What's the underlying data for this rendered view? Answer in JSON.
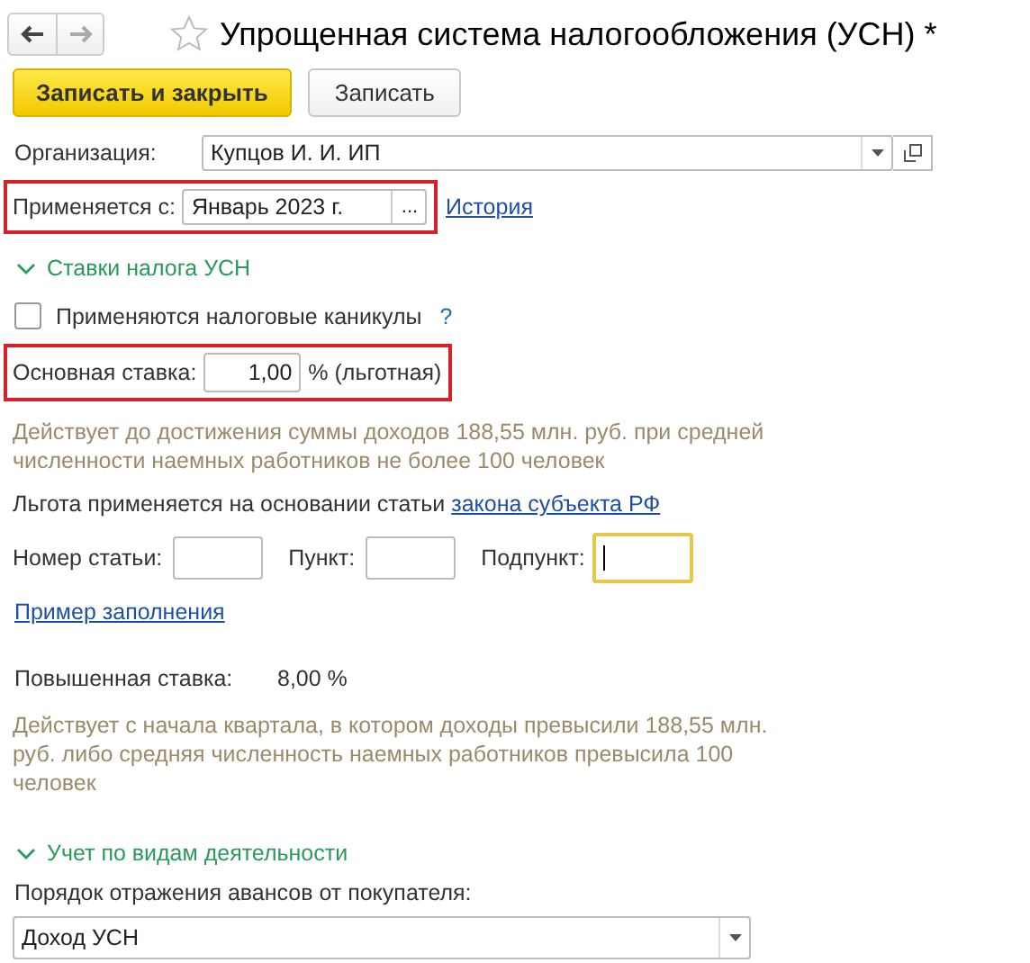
{
  "header": {
    "title": "Упрощенная система налогообложения (УСН) *",
    "favorite": false
  },
  "toolbar": {
    "buttons": [
      {
        "label": "Записать и закрыть",
        "kind": "primary"
      },
      {
        "label": "Записать",
        "kind": "default"
      }
    ]
  },
  "organization": {
    "label": "Организация:",
    "value": "Купцов И. И. ИП"
  },
  "applies_from": {
    "label": "Применяется с:",
    "value": "Январь 2023 г.",
    "button": "...",
    "link": "История",
    "highlighted": true
  },
  "rates_section": {
    "title": "Ставки налога УСН",
    "expanded": true
  },
  "holidays": {
    "label": "Применяются налоговые каникулы",
    "checked": false,
    "help": "?"
  },
  "base_rate": {
    "label": "Основная ставка:",
    "value": "1,00",
    "suffix": "% (льготная)",
    "highlighted": true
  },
  "base_note": "Действует до достижения суммы доходов 188,55 млн. руб. при средней численности наемных работников не более 100 человек",
  "benefit": {
    "text": "Льгота применяется на основании статьи",
    "link": "закона субъекта РФ"
  },
  "article_fields": [
    {
      "label": "Номер статьи:",
      "focused": false
    },
    {
      "label": "Пункт:",
      "focused": false
    },
    {
      "label": "Подпункт:",
      "focused": true
    }
  ],
  "example_link": "Пример заполнения",
  "increased_rate": {
    "label": "Повышенная ставка:",
    "value": "8,00 %"
  },
  "increased_note": "Действует с начала квартала, в котором доходы превысили 188,55 млн. руб. либо средняя численность наемных работников превысила 100 человек",
  "activity_section": {
    "title": "Учет по видам деятельности",
    "expanded": true
  },
  "advances": {
    "label": "Порядок отражения авансов от покупателя:",
    "value": "Доход УСН"
  }
}
